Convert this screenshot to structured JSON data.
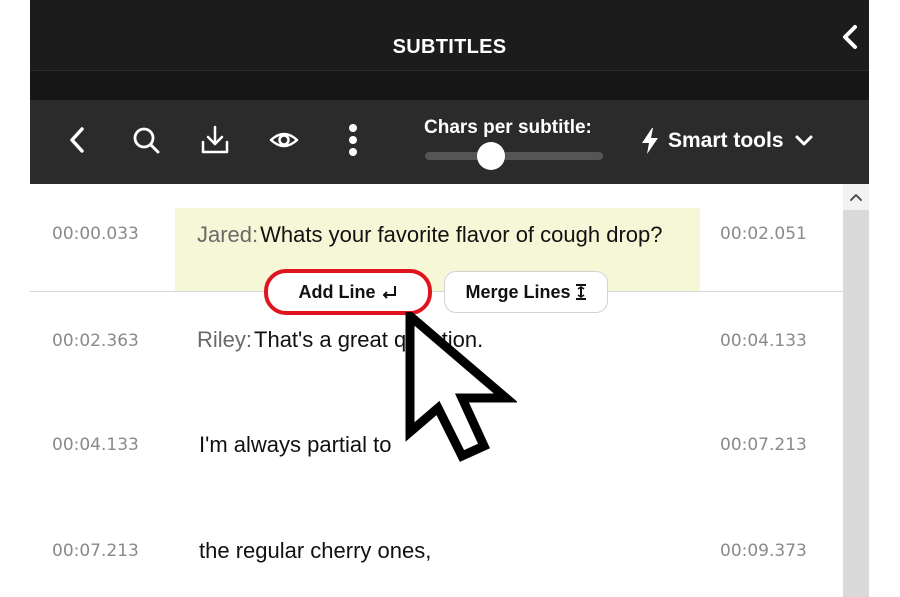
{
  "header": {
    "title": "SUBTITLES"
  },
  "toolbar": {
    "icons": [
      "back-icon",
      "search-icon",
      "download-icon",
      "eye-icon",
      "more-vertical-icon"
    ],
    "chars_label": "Chars per subtitle:",
    "chars_per_subtitle_level": 0.37,
    "smart_tools_label": "Smart tools"
  },
  "popup": {
    "add_line_label": "Add Line",
    "merge_lines_label": "Merge Lines"
  },
  "subtitles": [
    {
      "start": "00:00.033",
      "end": "00:02.051",
      "speaker": "Jared:",
      "text": "Whats your favorite flavor of cough drop?"
    },
    {
      "start": "00:02.363",
      "end": "00:04.133",
      "speaker": "Riley:",
      "text": "That's a great question."
    },
    {
      "start": "00:04.133",
      "end": "00:07.213",
      "speaker": "",
      "text": "I'm always partial to"
    },
    {
      "start": "00:07.213",
      "end": "00:09.373",
      "speaker": "",
      "text": "the regular cherry ones,"
    }
  ],
  "colors": {
    "active_row": "#f6f7d6",
    "highlight_ring": "#e0141e",
    "toolbar_bg": "#2b2b2b",
    "header_bg": "#1c1c1c"
  }
}
